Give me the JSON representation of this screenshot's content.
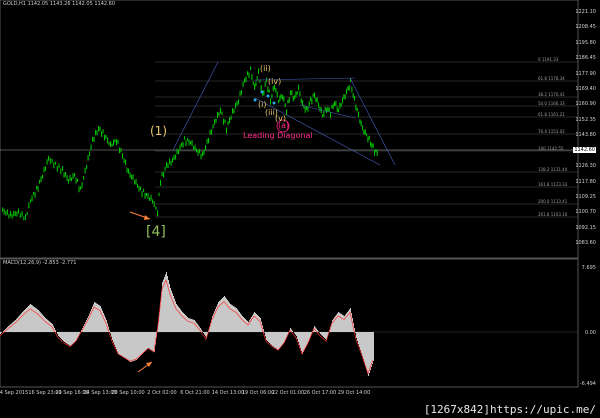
{
  "header": {
    "symbol_line": "GOLD,H1  1142.05 1143.26 1142.05 1142.60"
  },
  "price_axis": {
    "labels": [
      "1221.10",
      "1208.45",
      "1195.80",
      "1186.45",
      "1177.90",
      "1169.40",
      "1160.90",
      "1152.35",
      "1143.80",
      "1134.80",
      "1126.30",
      "1117.80",
      "1109.25",
      "1100.70",
      "1092.15",
      "1083.60"
    ],
    "current": "1142.60"
  },
  "time_axis": {
    "labels": [
      "4 Sep 2015",
      "16 Sep 23:00",
      "21 Sep 16:00",
      "24 Sep 13:00",
      "29 Sep 10:00",
      "2 Oct 02:00",
      "6 Oct 21:00",
      "14 Oct 13:00",
      "19 Oct 06:00",
      "22 Oct 01:00",
      "26 Oct 17:00",
      "29 Oct 14:00"
    ]
  },
  "macd_panel": {
    "header": "MACD(12,26,9) -2.853 -2.771",
    "labels": [
      "7.695",
      "0.00",
      "-6.494"
    ]
  },
  "fib_levels": [
    "0 1191.33",
    "61.8 1178.34",
    "38.2 1170.41",
    "50.0 1166.33",
    "61.8 1161.21",
    "76.4 1153.02",
    "100 1142.55",
    "138.2 1131.44",
    "161.8 1123.33",
    "200.0 1113.41",
    "261.8 1103.10"
  ],
  "waves": {
    "w1": "(1)",
    "w4": "[4]",
    "ii": "(ii)",
    "iv": "(iv)",
    "i": "(i)",
    "iii": "(iii)",
    "v": "(v)",
    "a": "(a)",
    "leading_diagonal": "Leading Diagonal"
  },
  "colors": {
    "up": "#00c000",
    "down": "#00c000",
    "fib": "#5f6a6a",
    "wave_yellow": "#e5c46a",
    "wave_green": "#8fbf5a",
    "wave_blue": "#2aa8e0",
    "pink": "#ff2d8a",
    "arrow": "#ff7f3a",
    "macd": "#c8c8c8",
    "signal": "#ff3030"
  },
  "watermark": "[1267x842]https://upic.me/"
}
